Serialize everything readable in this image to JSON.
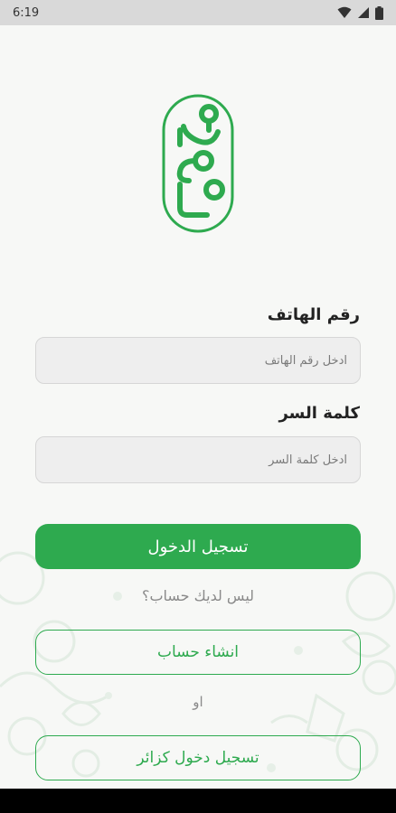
{
  "status_bar": {
    "time": "6:19"
  },
  "form": {
    "phone_label": "رقم الهاتف",
    "phone_placeholder": "ادخل رقم الهاتف",
    "password_label": "كلمة السر",
    "password_placeholder": "ادخل كلمة السر"
  },
  "actions": {
    "login_button": "تسجيل الدخول",
    "no_account_text": "ليس لديك حساب؟",
    "create_account_button": "انشاء حساب",
    "or_text": "او",
    "guest_login_button": "تسجيل دخول كزائر"
  },
  "colors": {
    "accent": "#2eaa4f",
    "background": "#f7f8f6"
  },
  "icons": {
    "wifi": "wifi-icon",
    "signal": "signal-icon",
    "battery": "battery-icon",
    "logo": "app-logo"
  }
}
